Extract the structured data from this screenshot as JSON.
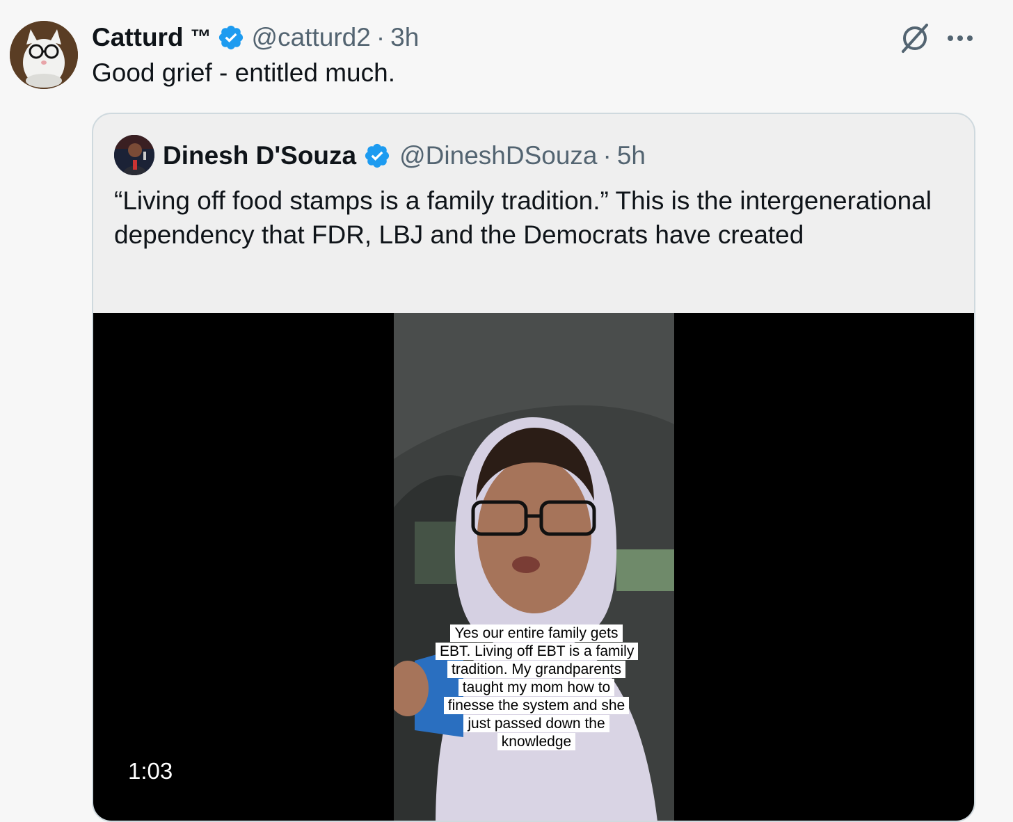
{
  "tweet": {
    "author_name": "Catturd",
    "trademark": "™",
    "handle": "@catturd2",
    "separator": "·",
    "time": "3h",
    "text": "Good grief - entitled much.",
    "avatar_icon": "cat-with-glasses-avatar",
    "verified_icon": "verified-badge-icon",
    "grok_icon": "grok-icon",
    "more_icon": "more-dots-icon"
  },
  "quoted_tweet": {
    "author_name": "Dinesh D'Souza",
    "handle": "@DineshDSouza",
    "separator": "·",
    "time": "5h",
    "text": "“Living off food stamps is a family tradition.” This is the intergenerational dependency that FDR, LBJ and the Democrats have created",
    "media": {
      "caption": "Yes our entire family gets EBT. Living off EBT is a family tradition. My grandparents taught my mom how to finesse the system and she just passed down the knowledge",
      "duration": "1:03"
    }
  },
  "colors": {
    "background": "#f7f7f7",
    "verified_blue": "#1d9bf0",
    "secondary_text": "#536471",
    "border": "#cfd9de"
  }
}
